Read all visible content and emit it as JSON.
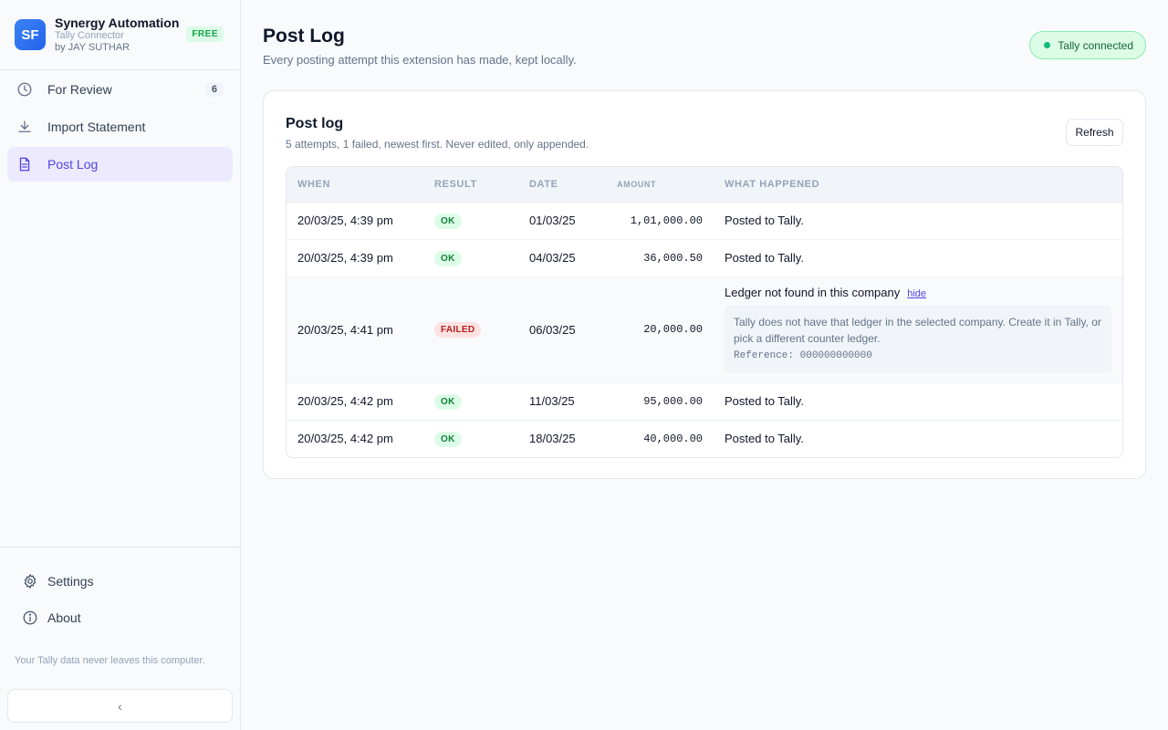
{
  "brand": {
    "logo_text": "SF",
    "name": "Synergy Automation",
    "sub": "Tally Connector",
    "by": "by JAY SUTHAR",
    "plan": "FREE"
  },
  "nav": [
    {
      "label": "For Review",
      "icon": "clock-icon",
      "count": "6"
    },
    {
      "label": "Import Statement",
      "icon": "download-icon"
    },
    {
      "label": "Post Log",
      "icon": "document-icon",
      "active": true
    }
  ],
  "bottom_nav": [
    {
      "label": "Settings",
      "icon": "gear-icon"
    },
    {
      "label": "About",
      "icon": "info-icon"
    }
  ],
  "privacy_note": "Your Tally data never leaves this computer.",
  "collapse_glyph": "‹",
  "page": {
    "title": "Post Log",
    "subtitle": "Every posting attempt this extension has made, kept locally.",
    "connection": "Tally connected"
  },
  "card": {
    "title": "Post log",
    "subtitle": "5 attempts, 1 failed, newest first. Never edited, only appended.",
    "refresh_label": "Refresh"
  },
  "table": {
    "headers": [
      "WHEN",
      "RESULT",
      "DATE",
      "AMOUNT",
      "WHAT HAPPENED"
    ],
    "rows": [
      {
        "when": "20/03/25, 4:39 pm",
        "result": "OK",
        "date": "01/03/25",
        "amount": "1,01,000.00",
        "what": "Posted to Tally."
      },
      {
        "when": "20/03/25, 4:39 pm",
        "result": "OK",
        "date": "04/03/25",
        "amount": "36,000.50",
        "what": "Posted to Tally."
      },
      {
        "when": "20/03/25, 4:41 pm",
        "result": "FAILED",
        "date": "06/03/25",
        "amount": "20,000.00",
        "what": "Ledger not found in this company",
        "hide_label": "hide",
        "detail": "Tally does not have that ledger in the selected company. Create it in Tally, or pick a different counter ledger.",
        "reference": "Reference: 000000000000"
      },
      {
        "when": "20/03/25, 4:42 pm",
        "result": "OK",
        "date": "11/03/25",
        "amount": "95,000.00",
        "what": "Posted to Tally."
      },
      {
        "when": "20/03/25, 4:42 pm",
        "result": "OK",
        "date": "18/03/25",
        "amount": "40,000.00",
        "what": "Posted to Tally."
      }
    ]
  },
  "colors": {
    "accent": "#4f46e5",
    "ok": "#15803d",
    "failed": "#b91c1c",
    "connected": "#10b981"
  }
}
